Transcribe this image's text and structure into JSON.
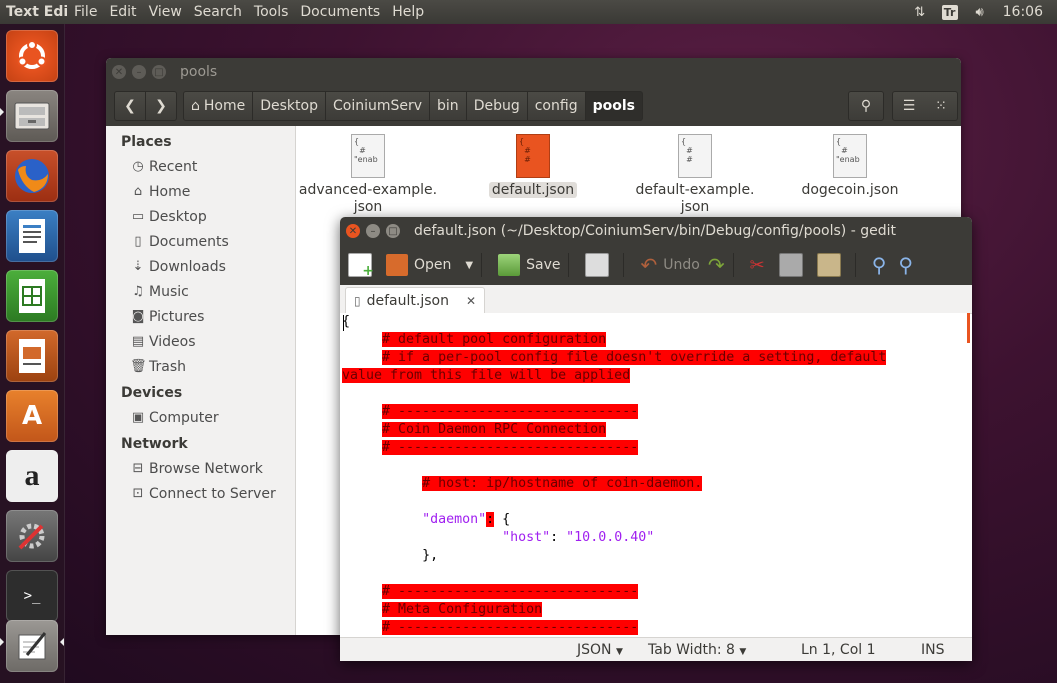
{
  "top_panel": {
    "app_title": "Text Edit",
    "menus": [
      "File",
      "Edit",
      "View",
      "Search",
      "Tools",
      "Documents",
      "Help"
    ],
    "keyboard_indicator": "Tr",
    "clock": "16:06"
  },
  "launcher": {
    "items": [
      "ubuntu-dash-icon",
      "files-icon",
      "firefox-icon",
      "writer-icon",
      "calc-icon",
      "impress-icon",
      "software-center-icon",
      "amazon-icon",
      "settings-icon",
      "terminal-icon",
      "text-editor-icon"
    ]
  },
  "files_window": {
    "title": "pools",
    "breadcrumbs": [
      "Home",
      "Desktop",
      "CoiniumServ",
      "bin",
      "Debug",
      "config",
      "pools"
    ],
    "sidebar": {
      "places_heading": "Places",
      "places": [
        "Recent",
        "Home",
        "Desktop",
        "Documents",
        "Downloads",
        "Music",
        "Pictures",
        "Videos",
        "Trash"
      ],
      "devices_heading": "Devices",
      "devices": [
        "Computer"
      ],
      "network_heading": "Network",
      "network": [
        "Browse Network",
        "Connect to Server"
      ]
    },
    "files": [
      {
        "name_line1": "advanced-example.",
        "name_line2": "json",
        "icon_text": "{\n   #\n   \"enab"
      },
      {
        "name_line1": "default.json",
        "name_line2": "",
        "icon_text": "{\n   #\n   #"
      },
      {
        "name_line1": "default-example.",
        "name_line2": "json",
        "icon_text": "{\n   #\n   #"
      },
      {
        "name_line1": "dogecoin.json",
        "name_line2": "",
        "icon_text": "{\n   #\n   \"enab"
      }
    ]
  },
  "gedit": {
    "title": "default.json (~/Desktop/CoiniumServ/bin/Debug/config/pools) - gedit",
    "toolbar": {
      "open": "Open",
      "save": "Save",
      "undo": "Undo"
    },
    "tab_label": "default.json",
    "status": {
      "language": "JSON",
      "tab_width": "Tab Width: 8",
      "position": "Ln 1, Col 1",
      "mode": "INS"
    },
    "lines": [
      "{",
      "# default pool configuration",
      "# if a per-pool config file doesn't override a setting, default",
      "value from this file will be applied",
      "",
      "# ------------------------------",
      "# Coin Daemon RPC Connection",
      "# ------------------------------",
      "",
      "# host: ip/hostname of coin-daemon.",
      "",
      "\"daemon\"",
      ": {",
      "\"host\"",
      ": ",
      "\"10.0.0.40\"",
      "},",
      "",
      "# ------------------------------",
      "# Meta Configuration",
      "# ------------------------------"
    ]
  }
}
